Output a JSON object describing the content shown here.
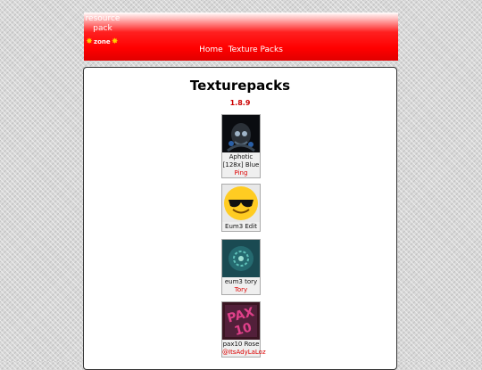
{
  "header": {
    "logo_line1": "resource",
    "logo_line2": "pack",
    "logo_zone": "zone",
    "nav": [
      "Home",
      "Texture Packs"
    ]
  },
  "main": {
    "title": "Texturepacks",
    "version": "1.8.9",
    "packs": [
      {
        "name": "Aphotic [128x] Blue",
        "author": "Ping"
      },
      {
        "name": "Eum3 Edit",
        "author": ""
      },
      {
        "name": "eum3 tory",
        "author": "Tory"
      },
      {
        "name": "pax10 Rose",
        "author": "@ItsAdyLaLoz"
      }
    ]
  },
  "colors": {
    "header_red": "#ff0000",
    "author_red": "#dd0000",
    "version_red": "#cc0000"
  }
}
